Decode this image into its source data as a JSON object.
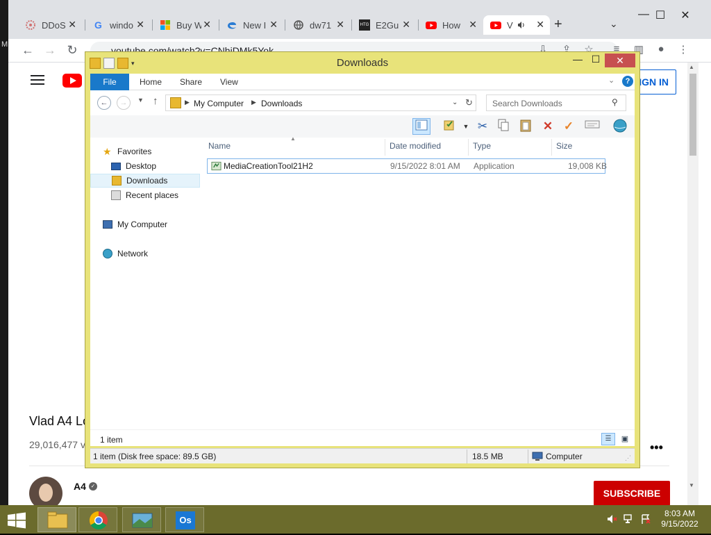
{
  "chrome": {
    "left_strip_text": "M",
    "tabs": [
      {
        "title": "DDoS",
        "icon": "ddos-site-icon",
        "color": "#c44"
      },
      {
        "title": "windo",
        "icon": "google-icon",
        "color": "#4285f4"
      },
      {
        "title": "Buy W",
        "icon": "microsoft-icon",
        "color": "#f25022"
      },
      {
        "title": "New I",
        "icon": "edge-icon",
        "color": "#2b7cd3"
      },
      {
        "title": "dw71",
        "icon": "globe-icon",
        "color": "#555"
      },
      {
        "title": "E2Gu",
        "icon": "htg-icon",
        "color": "#222"
      },
      {
        "title": "How",
        "icon": "youtube-icon",
        "color": "#ff0000"
      },
      {
        "title": "V",
        "icon": "youtube-icon",
        "color": "#ff0000",
        "audio": true,
        "active": true
      }
    ],
    "htg_label": "HTG",
    "new_tab_symbol": "+",
    "tab_search_symbol": "⌄",
    "address": "youtube.com/watch?v=CNhiDMk5Yok"
  },
  "youtube": {
    "sign_in": "SIGN IN",
    "video_title": "Vlad A4 Lo",
    "views": "29,016,477 v",
    "more": "•••",
    "channel": "A4",
    "subscribe": "SUBSCRIBE"
  },
  "explorer": {
    "title": "Downloads",
    "ribbon_tabs": {
      "file": "File",
      "home": "Home",
      "share": "Share",
      "view": "View"
    },
    "help": "?",
    "breadcrumb": [
      "My Computer",
      "Downloads"
    ],
    "search_placeholder": "Search Downloads",
    "nav": {
      "favorites": "Favorites",
      "desktop": "Desktop",
      "downloads": "Downloads",
      "recent": "Recent places",
      "computer": "My Computer",
      "network": "Network"
    },
    "columns": {
      "name": "Name",
      "date": "Date modified",
      "type": "Type",
      "size": "Size"
    },
    "files": [
      {
        "name": "MediaCreationTool21H2",
        "date": "9/15/2022 8:01 AM",
        "type": "Application",
        "size": "19,008 KB"
      }
    ],
    "item_count": "1 item",
    "status": {
      "summary": "1 item (Disk free space: 89.5 GB)",
      "size": "18.5 MB",
      "location": "Computer"
    }
  },
  "taskbar": {
    "time": "8:03 AM",
    "date": "9/15/2022",
    "outlook_label": "Os"
  }
}
